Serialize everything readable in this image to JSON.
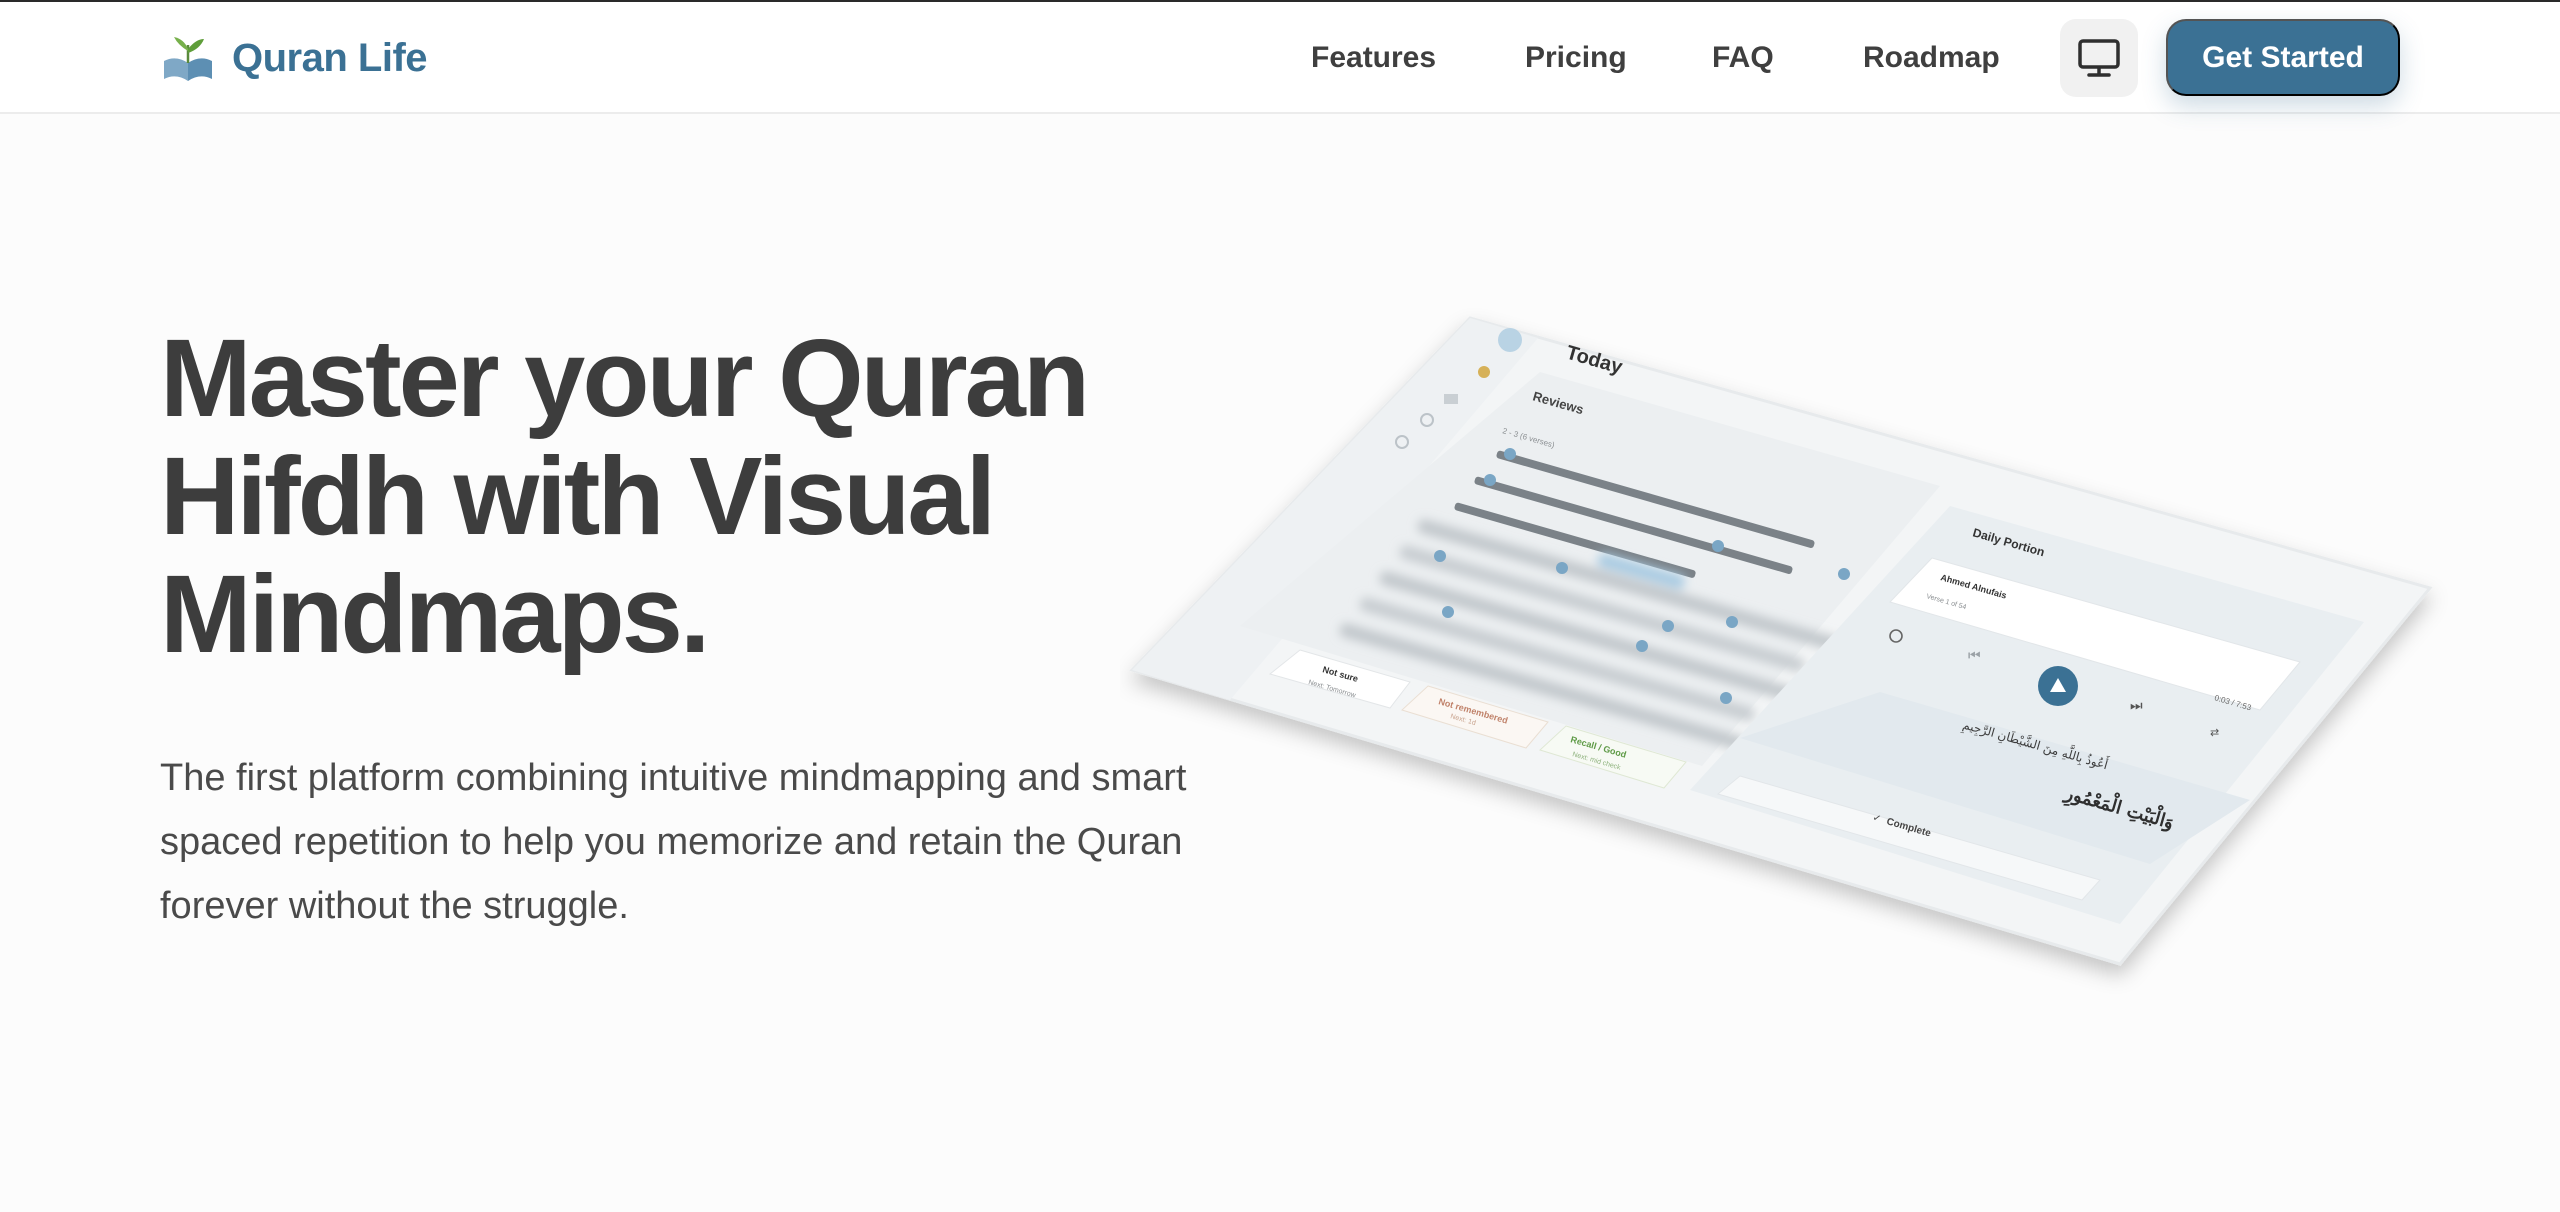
{
  "brand": {
    "name": "Quran Life",
    "logo_icon": "open-book-plant-icon"
  },
  "nav": {
    "links": [
      "Features",
      "Pricing",
      "FAQ",
      "Roadmap"
    ],
    "display_icon": "monitor-icon",
    "cta_label": "Get Started"
  },
  "hero": {
    "title_lines": [
      "Master your Quran",
      "Hifdh with Visual",
      "Mindmaps."
    ],
    "subtitle_lines": [
      "The first platform combining intuitive mindmapping and smart",
      "spaced repetition to help you memorize and retain the Quran",
      "forever without the struggle."
    ]
  },
  "preview": {
    "header_title": "Today",
    "reviews_title": "Reviews",
    "reviews_range": "2 - 3 (6 verses)",
    "daily_portion_title": "Daily Portion",
    "reciter": "Ahmed Alnufais",
    "verse_progress": "Verse 1 of 54",
    "time": "0:03 / 7:53",
    "buttons": [
      {
        "label": "Not sure",
        "sub": "Next: Tomorrow"
      },
      {
        "label": "Not remembered",
        "sub": "Next: 1d"
      },
      {
        "label": "Recall / Good",
        "sub": "Next: mid check"
      }
    ],
    "complete_label": "Complete",
    "arabic_line_1": "أَعُوذُ بِاللَّهِ مِنَ الشَّيْطَانِ الرَّجِيمِ",
    "arabic_line_2": "وَالْبَيْتِ الْمَعْمُورِ",
    "colors": {
      "accent": "#3b7194",
      "text": "#3d3d3d",
      "background": "#fcfcfc"
    }
  }
}
